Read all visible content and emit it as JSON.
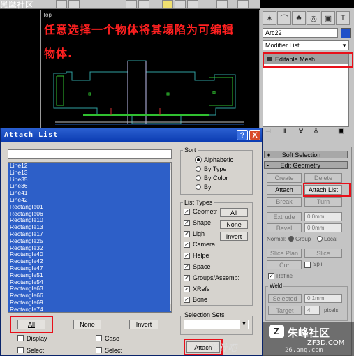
{
  "watermark_top": "黑鹰社区",
  "viewport": {
    "label": "Top",
    "caption_line1": "任意选择一个物体将其塌陷为可编辑",
    "caption_line2": "物体."
  },
  "command_panel": {
    "object_name": "Arc22",
    "modifier_list": "Modifier List",
    "stack_item": "Editable Mesh",
    "soft_selection": "Soft Selection",
    "edit_geometry": "Edit Geometry",
    "create": "Create",
    "delete": "Delete",
    "attach": "Attach",
    "attach_list": "Attach List",
    "break": "Break",
    "turn": "Turn",
    "extrude": "Extrude",
    "extrude_value": "0.0mm",
    "bevel": "Bevel",
    "bevel_value": "0.0mm",
    "normal": "Normal:",
    "group": "Group",
    "local": "Local",
    "slice_plane": "Slice Plan",
    "slice": "Slice",
    "cut": "Cut",
    "split": "Spli",
    "refine": "Refine",
    "weld": "Weld",
    "selected": "Selected",
    "selected_value": "0.1mm",
    "target": "Target",
    "target_value": "4",
    "pixels": "pixels"
  },
  "dialog": {
    "title": "Attach List",
    "help": "?",
    "close": "X",
    "items": [
      "Line12",
      "Line13",
      "Line35",
      "Line36",
      "Line41",
      "Line42",
      "Rectangle01",
      "Rectangle06",
      "Rectangle10",
      "Rectangle13",
      "Rectangle17",
      "Rectangle25",
      "Rectangle32",
      "Rectangle40",
      "Rectangle42",
      "Rectangle47",
      "Rectangle51",
      "Rectangle54",
      "Rectangle63",
      "Rectangle66",
      "Rectangle69",
      "Rectangle74"
    ],
    "all": "All",
    "none": "None",
    "invert": "Invert",
    "display": "Display",
    "case": "Case",
    "select1": "Select",
    "select2": "Select",
    "sort": {
      "title": "Sort",
      "options": [
        "Alphabetic",
        "By Type",
        "By Color",
        "By"
      ],
      "selected": "Alphabetic"
    },
    "list_types": {
      "title": "List Types",
      "items": [
        "Geometr",
        "Shape",
        "Ligh",
        "Camera",
        "Helpe",
        "Space",
        "Groups/Assemb:",
        "XRefs",
        "Bone"
      ],
      "all": "All",
      "none": "None",
      "invert": "Invert"
    },
    "selection_sets": "Selection Sets",
    "attach_button": "Attach"
  },
  "watermarks": {
    "site": "朱峰社区",
    "url": "ZF3D.COM",
    "cn": "设计吧",
    "url2": "26.ang.com"
  },
  "colors": {
    "selection_blue": "#2d5fc8",
    "title_blue": "#0a3ab0",
    "highlight_red": "#e8101a",
    "caption_red": "#ff2020"
  }
}
